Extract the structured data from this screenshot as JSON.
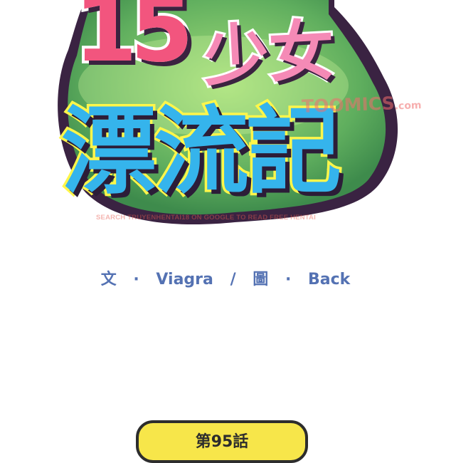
{
  "logo": {
    "number": "15",
    "girl": "少女",
    "main": "漂流記"
  },
  "watermark": {
    "brand": "TOOMICS",
    "brand_suffix": ".com",
    "text": "SEARCH TRUYENHENTAI18 ON GOOGLE TO READ FREE HENTAI"
  },
  "credits": {
    "writer_label": "文",
    "sep1": "·",
    "writer": "Viagra",
    "slash": "/",
    "artist_label": "圖",
    "sep2": "·",
    "artist": "Back"
  },
  "episode": {
    "label": "第95話"
  }
}
